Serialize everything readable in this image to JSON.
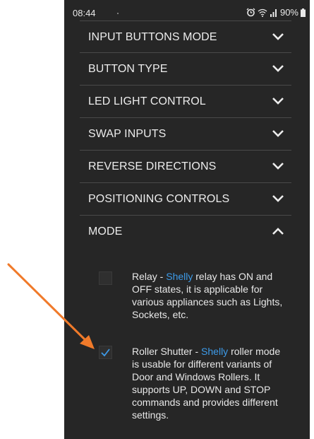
{
  "status_bar": {
    "time": "08:44",
    "battery": "90%"
  },
  "menu": {
    "items": [
      {
        "label": "INPUT BUTTONS MODE",
        "state": "collapsed"
      },
      {
        "label": "BUTTON TYPE",
        "state": "collapsed"
      },
      {
        "label": "LED LIGHT CONTROL",
        "state": "collapsed"
      },
      {
        "label": "SWAP INPUTS",
        "state": "collapsed"
      },
      {
        "label": "REVERSE DIRECTIONS",
        "state": "collapsed"
      },
      {
        "label": "POSITIONING CONTROLS",
        "state": "collapsed"
      },
      {
        "label": "MODE",
        "state": "expanded"
      }
    ]
  },
  "mode_options": [
    {
      "checked": false,
      "prefix": "Relay - ",
      "brand": "Shelly",
      "description": " relay has ON and OFF states, it is applicable for various appliances such as Lights, Sockets, etc."
    },
    {
      "checked": true,
      "prefix": "Roller Shutter - ",
      "brand": "Shelly",
      "description": " roller mode is usable for different variants of Door and Windows Rollers. It supports UP, DOWN and STOP commands and provides different settings."
    }
  ],
  "colors": {
    "background": "#262626",
    "text": "#ececec",
    "accent": "#3d9be9",
    "arrow": "#f07a2a",
    "divider": "#4a4a4a"
  },
  "icons": {
    "collapsed": "chevron-down-icon",
    "expanded": "chevron-up-icon",
    "checked": "checkmark-icon"
  }
}
